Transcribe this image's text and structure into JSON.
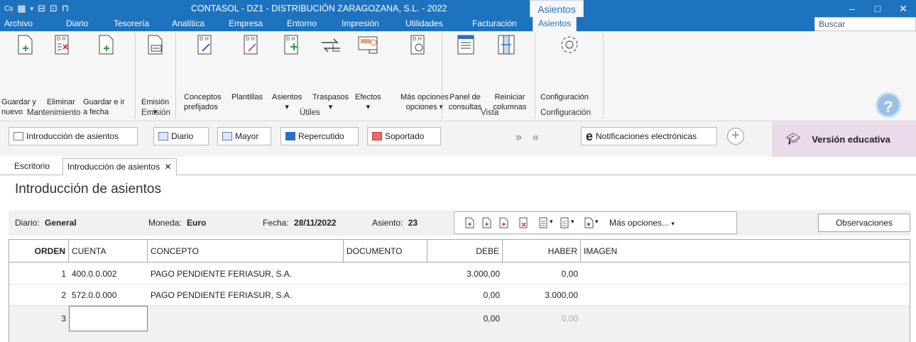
{
  "window": {
    "title": "CONTASOL - DZ1 - DISTRIBUCIÓN ZARAGOZANA, S.L. - 2022",
    "context_tab": "Asientos",
    "controls": [
      "–",
      "□",
      "✕"
    ]
  },
  "menu": {
    "items": [
      "Archivo",
      "Diario",
      "Tesorería",
      "Analítica",
      "Empresa",
      "Entorno",
      "Impresión",
      "Utilidades",
      "Facturación",
      "Asientos"
    ],
    "search_placeholder": "Buscar"
  },
  "ribbon": {
    "buttons": {
      "guardar_nuevo": "Guardar y nuevo",
      "eliminar": "Eliminar",
      "guardar_fecha": "Guardar e ir a fecha",
      "emision": "Emisión",
      "conceptos": "Conceptos prefijados",
      "plantillas": "Plantillas",
      "asientos": "Asientos",
      "traspasos": "Traspasos",
      "efectos": "Efectos",
      "mas_opciones": "Más opciones",
      "panel": "Panel de consultas",
      "reiniciar": "Reiniciar columnas",
      "configuracion": "Configuración"
    },
    "groups": {
      "mantenimiento": "Mantenimiento",
      "emision": "Emisión",
      "utiles": "Útiles",
      "vista": "Vista",
      "configuracion": "Configuración"
    }
  },
  "toolbar": {
    "introduccion": "Introducción de asientos",
    "diario": "Diario",
    "mayor": "Mayor",
    "repercutido": "Repercutido",
    "soportado": "Soportado",
    "notificaciones": "Notificaciones electrónicas",
    "version": "Versión educativa"
  },
  "tabs": {
    "escritorio": "Escritorio",
    "introduccion": "Introducción de asientos"
  },
  "page_title": "Introducción de asientos",
  "filter": {
    "diario_label": "Diario:",
    "diario_value": "General",
    "moneda_label": "Moneda:",
    "moneda_value": "Euro",
    "fecha_label": "Fecha:",
    "fecha_value": "28/11/2022",
    "asiento_label": "Asiento:",
    "asiento_value": "23",
    "mas_opciones": "Más opciones...",
    "observaciones": "Observaciones"
  },
  "grid": {
    "headers": {
      "orden": "ORDEN",
      "cuenta": "CUENTA",
      "concepto": "CONCEPTO",
      "documento": "DOCUMENTO",
      "debe": "DEBE",
      "haber": "HABER",
      "imagen": "IMAGEN"
    },
    "rows": [
      {
        "orden": "1",
        "cuenta": "400.0.0.002",
        "concepto": "PAGO PENDIENTE FERIASUR, S.A.",
        "documento": "",
        "debe": "3.000,00",
        "haber": "0,00"
      },
      {
        "orden": "2",
        "cuenta": "572.0.0.000",
        "concepto": "PAGO PENDIENTE FERIASUR, S.A.",
        "documento": "",
        "debe": "0,00",
        "haber": "3.000,00"
      },
      {
        "orden": "3",
        "cuenta": "",
        "concepto": "",
        "documento": "",
        "debe": "0,00",
        "haber": "0,00"
      }
    ]
  },
  "colors": {
    "brand": "#1e73be",
    "edu_bg": "#e9dbea",
    "help": "#9bc0e4"
  }
}
